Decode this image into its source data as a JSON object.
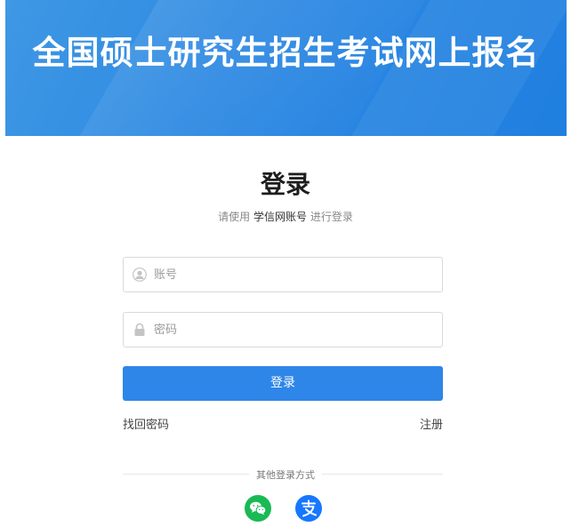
{
  "banner": {
    "title": "全国硕士研究生招生考试网上报名"
  },
  "login": {
    "title": "登录",
    "subtitle_prefix": "请使用 ",
    "subtitle_account": "学信网账号",
    "subtitle_suffix": " 进行登录",
    "username_placeholder": "账号",
    "password_placeholder": "密码",
    "submit_label": "登录",
    "forgot_link": "找回密码",
    "register_link": "注册"
  },
  "other_login": {
    "label": "其他登录方式",
    "options": [
      {
        "name": "wechat",
        "icon": "wechat-icon",
        "color": "#19b955"
      },
      {
        "name": "alipay",
        "icon": "alipay-icon",
        "color": "#1677ff"
      }
    ]
  }
}
